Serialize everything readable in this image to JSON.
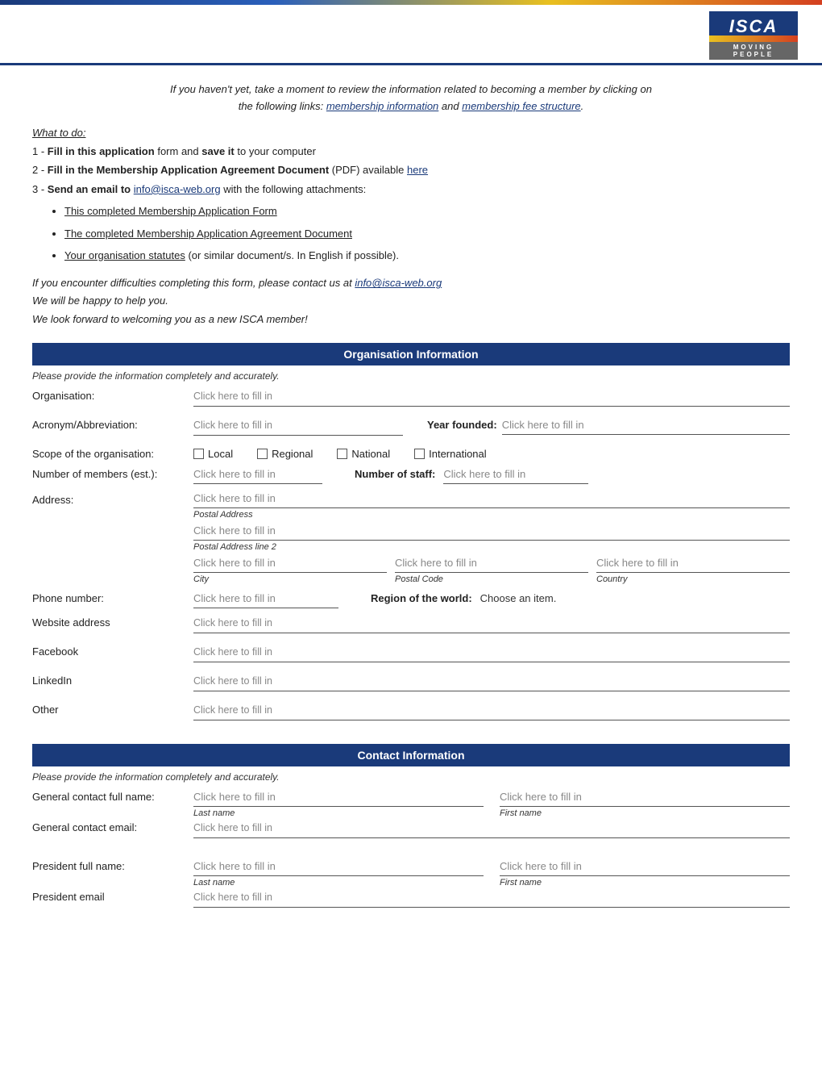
{
  "header": {
    "logo_main": "ISCA",
    "logo_subtitle": "MOVING PEOPLE"
  },
  "intro": {
    "text1": "If you haven't yet, take a moment to review the information related to becoming a member by clicking on",
    "text2": "the following links:",
    "link1_text": "membership information",
    "link1_href": "#",
    "text3": "and",
    "link2_text": "membership fee structure",
    "link2_href": "#",
    "period": "."
  },
  "what_to_do": {
    "heading": "What to do:",
    "step1_prefix": "1 -",
    "step1_bold1": "Fill in this application",
    "step1_mid": "form and",
    "step1_bold2": "save it",
    "step1_suffix": "to your computer",
    "step2_prefix": "2 -",
    "step2_bold": "Fill in the Membership Application Agreement Document",
    "step2_mid": "(PDF) available",
    "step2_link": "here",
    "step3_prefix": "3 -",
    "step3_bold": "Send an email to",
    "step3_email": "info@isca-web.org",
    "step3_suffix": "with the following attachments:",
    "bullets": [
      "This completed Membership Application Form",
      "The completed Membership Application Agreement Document",
      "Your organisation statutes (or similar document/s. In English if possible)."
    ]
  },
  "contact_note": {
    "line1_prefix": "If you encounter difficulties completing this form, please contact us at",
    "line1_email": "info@isca-web.org",
    "line2": "We will be happy to help you.",
    "line3": "We look forward to welcoming you as a new ISCA member!"
  },
  "org_section": {
    "title": "Organisation Information",
    "note": "Please provide the information completely and accurately.",
    "fields": {
      "organisation_label": "Organisation:",
      "organisation_placeholder": "Click here to fill in",
      "acronym_label": "Acronym/Abbreviation:",
      "acronym_placeholder": "Click here to fill in",
      "year_founded_label": "Year founded:",
      "year_founded_placeholder": "Click here to fill in",
      "scope_label": "Scope of the organisation:",
      "scope_options": [
        "Local",
        "Regional",
        "National",
        "International"
      ],
      "members_label": "Number of members (est.):",
      "members_placeholder": "Click here to fill in",
      "staff_label": "Number of staff:",
      "staff_placeholder": "Click here to fill in",
      "address_label": "Address:",
      "address1_placeholder": "Click here to fill in",
      "address1_sub": "Postal Address",
      "address2_placeholder": "Click here to fill in",
      "address2_sub": "Postal Address line 2",
      "city_placeholder": "Click here to fill in",
      "city_sub": "City",
      "postal_placeholder": "Click here to fill in",
      "postal_sub": "Postal Code",
      "country_placeholder": "Click here to fill in",
      "country_sub": "Country",
      "phone_label": "Phone number:",
      "phone_placeholder": "Click here to fill in",
      "region_label": "Region of the world:",
      "region_value": "Choose an item.",
      "website_label": "Website address",
      "website_placeholder": "Click here to fill in",
      "facebook_label": "Facebook",
      "facebook_placeholder": "Click here to fill in",
      "linkedin_label": "LinkedIn",
      "linkedin_placeholder": "Click here to fill in",
      "other_label": "Other",
      "other_placeholder": "Click here to fill in"
    }
  },
  "contact_section": {
    "title": "Contact Information",
    "note": "Please provide the information completely and accurately.",
    "fields": {
      "general_contact_label": "General contact full name:",
      "general_contact_last_placeholder": "Click here to fill in",
      "general_contact_last_sub": "Last name",
      "general_contact_first_placeholder": "Click here to fill in",
      "general_contact_first_sub": "First name",
      "general_email_label": "General contact email:",
      "general_email_placeholder": "Click here to fill in",
      "president_name_label": "President full name:",
      "president_last_placeholder": "Click here to fill in",
      "president_last_sub": "Last name",
      "president_first_placeholder": "Click here to fill in",
      "president_first_sub": "First name",
      "president_email_label": "President email",
      "president_email_placeholder": "Click here to fill in"
    }
  }
}
